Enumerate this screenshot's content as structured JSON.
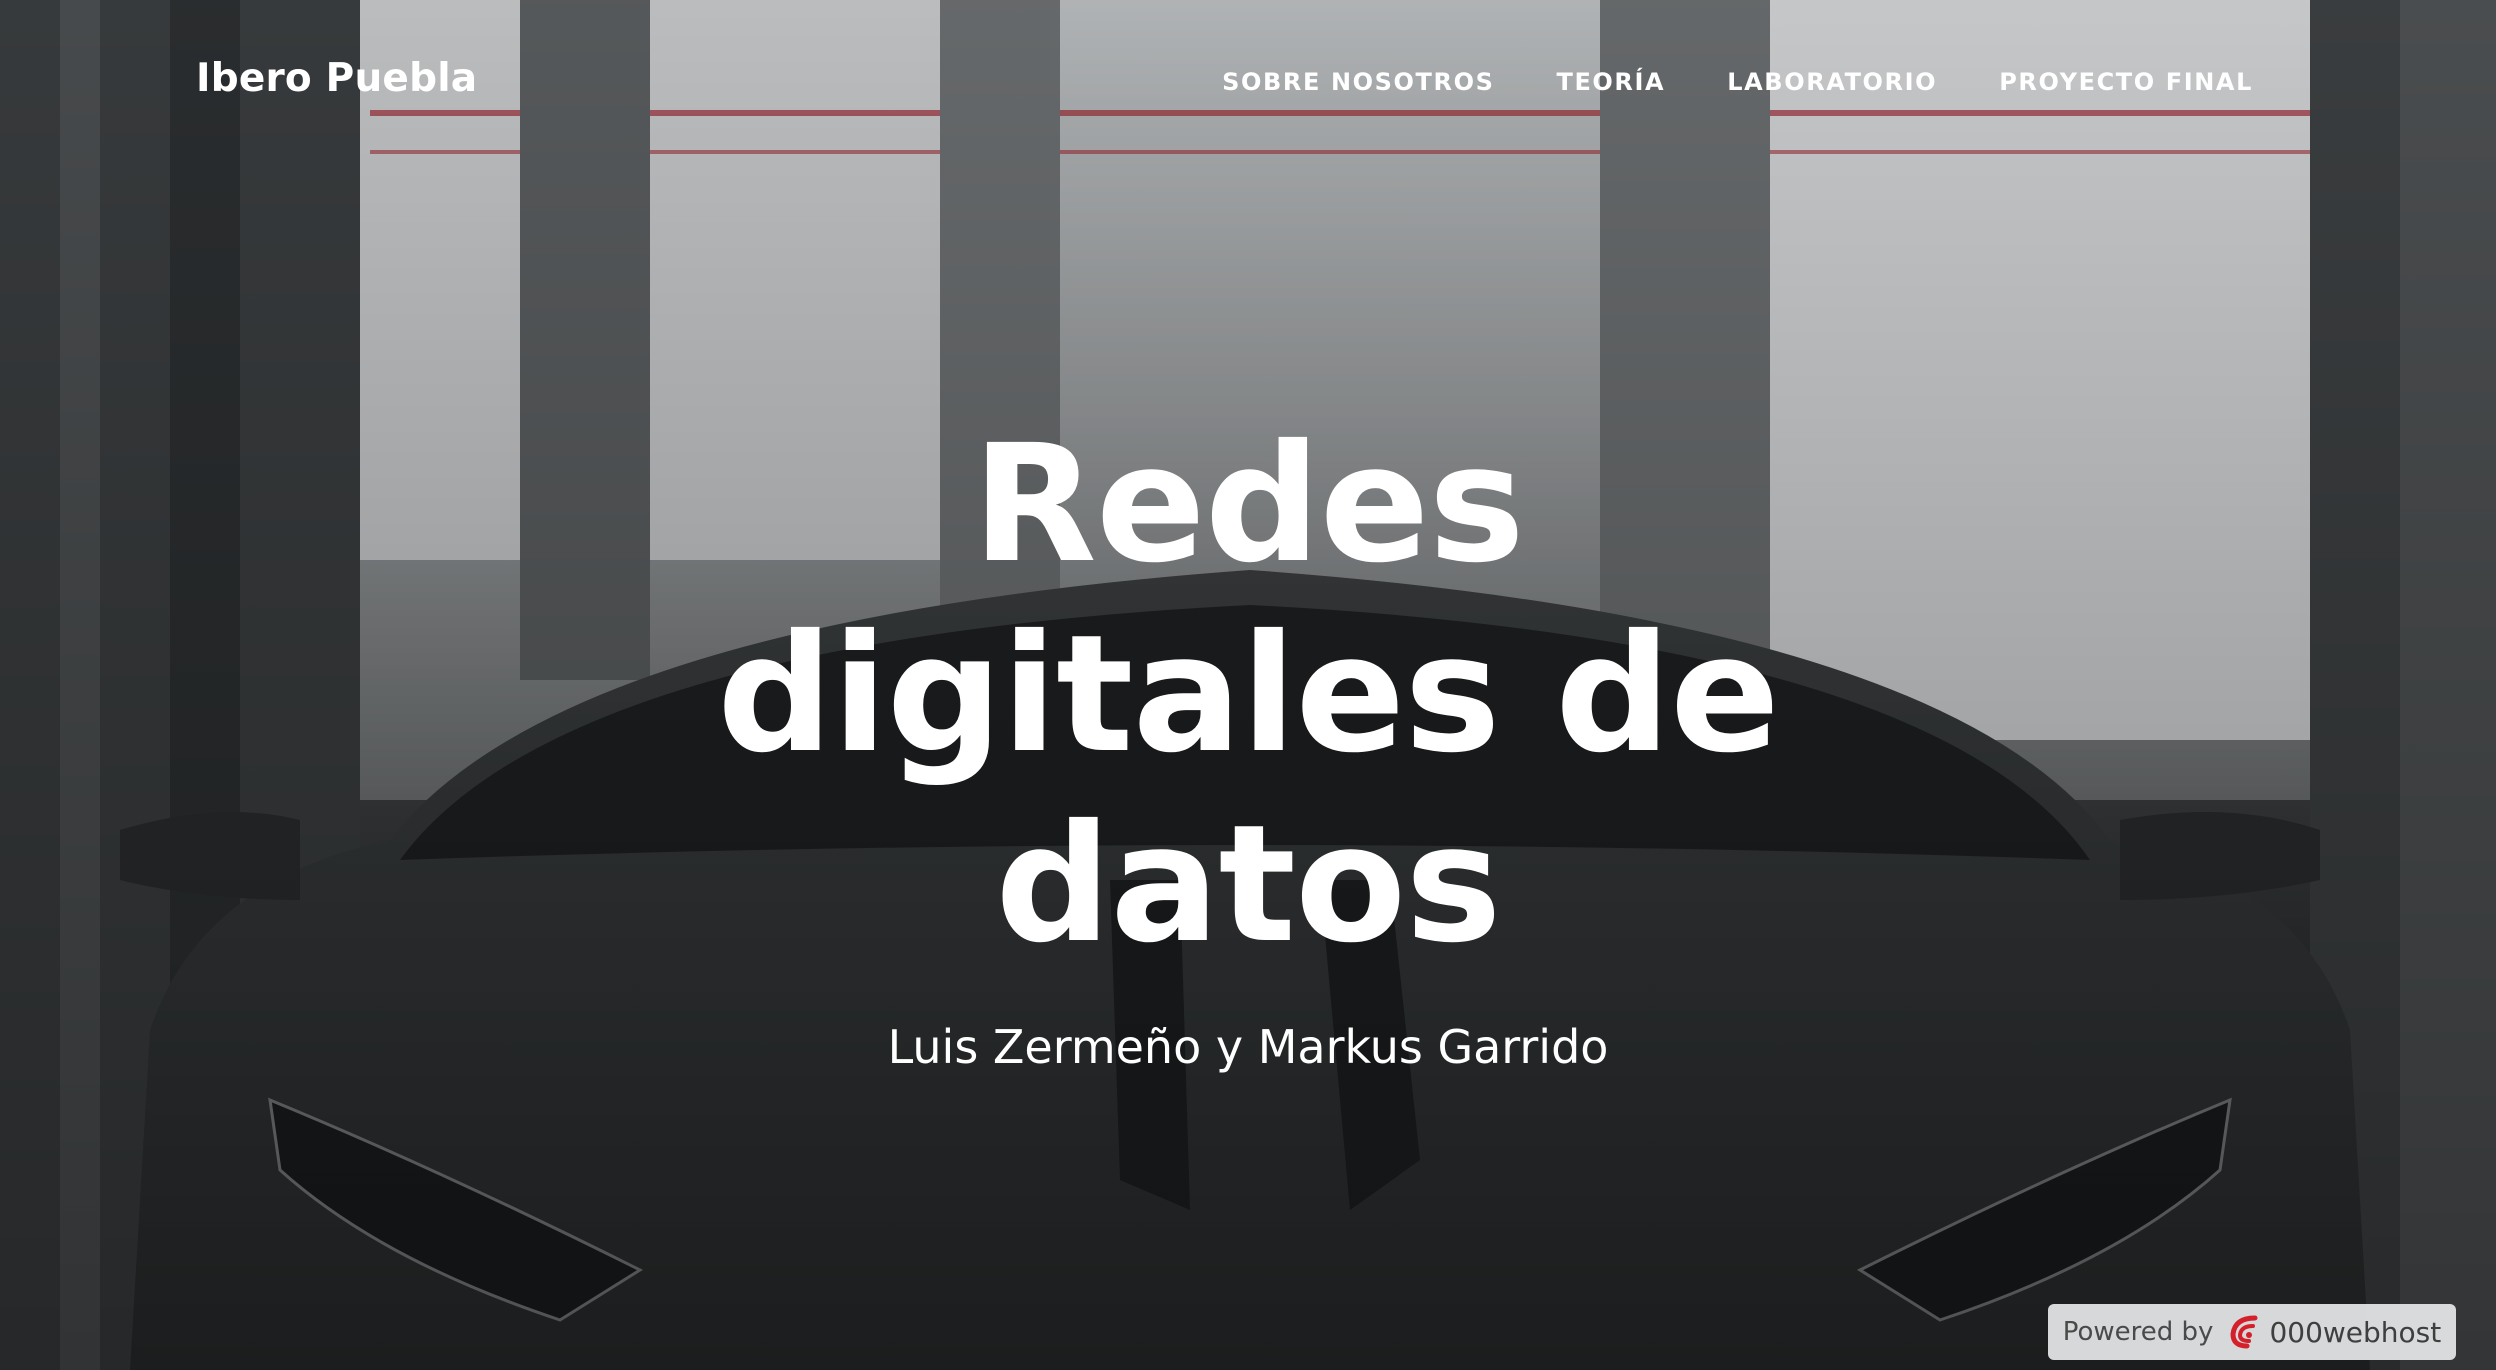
{
  "navbar": {
    "brand": "Ibero Puebla",
    "links": [
      {
        "label": "SOBRE NOSOTROS"
      },
      {
        "label": "TEORÍA"
      },
      {
        "label": "LABORATORIO"
      },
      {
        "label": "PROYECTO FINAL"
      }
    ]
  },
  "masthead": {
    "title": "Redes digitales de datos",
    "subtitle": "Luis Zermeño y Markus Garrido"
  },
  "badge": {
    "powered_label": "Powered by",
    "provider": "000webhost",
    "accent_color": "#d4202b"
  },
  "background": {
    "image": "car-in-showroom-photo",
    "overlay_color": "#000000"
  }
}
